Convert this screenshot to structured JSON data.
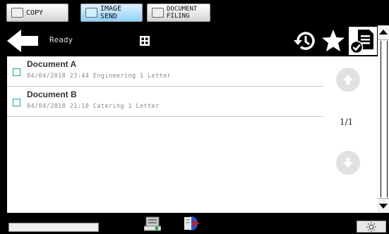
{
  "tabs": [
    {
      "label": "COPY",
      "active": false
    },
    {
      "label": "IMAGE SEND",
      "active": true
    },
    {
      "label_line1": "DOCUMENT",
      "label_line2": "FILING",
      "active": false
    }
  ],
  "header": {
    "status": "Ready"
  },
  "icons": {
    "back": "back-arrow-icon",
    "view": "grid-view-icon",
    "history": "history-icon",
    "favorite": "star-icon",
    "doc_select": "document-check-icon",
    "brightness": "sun-icon"
  },
  "documents": [
    {
      "title": "Document A",
      "meta": "04/04/2018 23:44 Engineering 1 Letter"
    },
    {
      "title": "Document B",
      "meta": "04/04/2018 21:10 Catering 1 Letter"
    }
  ],
  "pagination": {
    "text": "1/1"
  },
  "progress": {
    "fraction": 0.0
  },
  "colors": {
    "accent_tab": "#8fd1f7",
    "checkbox": "#19a0a0"
  }
}
